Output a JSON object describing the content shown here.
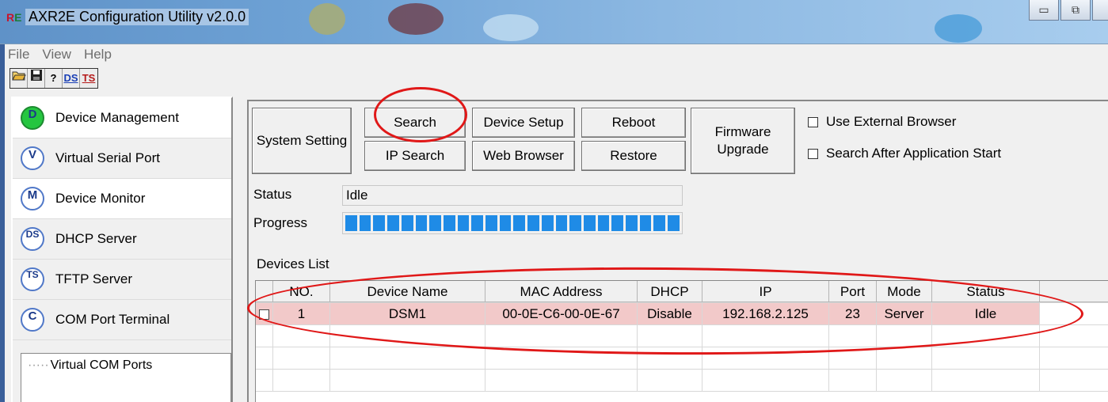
{
  "window": {
    "title": "AXR2E Configuration Utility v2.0.0",
    "minimize_glyph": "▭",
    "restore_glyph": "⧉"
  },
  "menu": [
    "File",
    "View",
    "Help"
  ],
  "toolbar": {
    "icons": [
      "open-folder-icon",
      "save-icon",
      "help-icon"
    ],
    "help_glyph": "?",
    "ds_label": "DS",
    "ts_label": "TS"
  },
  "sidebar": {
    "items": [
      {
        "badge": "D",
        "label": "Device Management"
      },
      {
        "badge": "V",
        "label": "Virtual Serial Port"
      },
      {
        "badge": "M",
        "label": "Device Monitor"
      },
      {
        "badge": "DS",
        "label": "DHCP Server"
      },
      {
        "badge": "TS",
        "label": "TFTP Server"
      },
      {
        "badge": "C",
        "label": "COM Port Terminal"
      }
    ],
    "tree_root": "Virtual COM Ports",
    "tree_branch": "·····"
  },
  "buttons": {
    "system_setting": "System Setting",
    "search": "Search",
    "ip_search": "IP Search",
    "device_setup": "Device Setup",
    "web_browser": "Web Browser",
    "reboot": "Reboot",
    "restore": "Restore",
    "firmware_upgrade": "Firmware Upgrade"
  },
  "options": {
    "use_external_browser": "Use External Browser",
    "search_after_start": "Search After Application Start"
  },
  "status": {
    "status_label": "Status",
    "status_value": "Idle",
    "progress_label": "Progress",
    "progress_fraction": 1.0
  },
  "devices": {
    "list_label": "Devices List",
    "columns": [
      "NO.",
      "Device Name",
      "MAC Address",
      "DHCP",
      "IP",
      "Port",
      "Mode",
      "Status"
    ],
    "rows": [
      {
        "no": "1",
        "name": "DSM1",
        "mac": "00-0E-C6-00-0E-67",
        "dhcp": "Disable",
        "ip": "192.168.2.125",
        "port": "23",
        "mode": "Server",
        "status": "Idle"
      }
    ]
  },
  "colors": {
    "annotation": "#e01818",
    "row_highlight": "#f2c9c9",
    "progress": "#1f8be6"
  }
}
